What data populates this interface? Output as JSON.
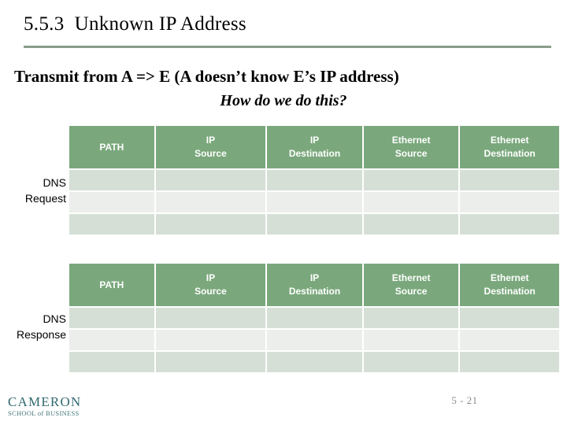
{
  "slide": {
    "title": "5.5.3  Unknown IP Address",
    "statement": "Transmit from A => E (A doesn’t know E’s IP address)",
    "question": "How do we do this?"
  },
  "colors": {
    "header_green": "#7AA87C",
    "rule_green": "#8A9D8A",
    "row_shaded": "#D5DFD6",
    "row_light": "#EBEEEB",
    "logo_teal": "#1F5C63",
    "page_number_gray": "#8C8C8C"
  },
  "tables": [
    {
      "label_line1": "DNS",
      "label_line2": "Request",
      "columns": [
        {
          "line1": "PATH",
          "line2": ""
        },
        {
          "line1": "IP",
          "line2": "Source"
        },
        {
          "line1": "IP",
          "line2": "Destination"
        },
        {
          "line1": "Ethernet",
          "line2": "Source"
        },
        {
          "line1": "Ethernet",
          "line2": "Destination"
        }
      ],
      "rows": [
        [
          "",
          "",
          "",
          "",
          ""
        ],
        [
          "",
          "",
          "",
          "",
          ""
        ],
        [
          "",
          "",
          "",
          "",
          ""
        ]
      ]
    },
    {
      "label_line1": "DNS",
      "label_line2": "Response",
      "columns": [
        {
          "line1": "PATH",
          "line2": ""
        },
        {
          "line1": "IP",
          "line2": "Source"
        },
        {
          "line1": "IP",
          "line2": "Destination"
        },
        {
          "line1": "Ethernet",
          "line2": "Source"
        },
        {
          "line1": "Ethernet",
          "line2": "Destination"
        }
      ],
      "rows": [
        [
          "",
          "",
          "",
          "",
          ""
        ],
        [
          "",
          "",
          "",
          "",
          ""
        ],
        [
          "",
          "",
          "",
          "",
          ""
        ]
      ]
    }
  ],
  "footer": {
    "logo_primary": "CAMERON",
    "logo_secondary": "SCHOOL of BUSINESS",
    "page_number": "5 - 21"
  }
}
